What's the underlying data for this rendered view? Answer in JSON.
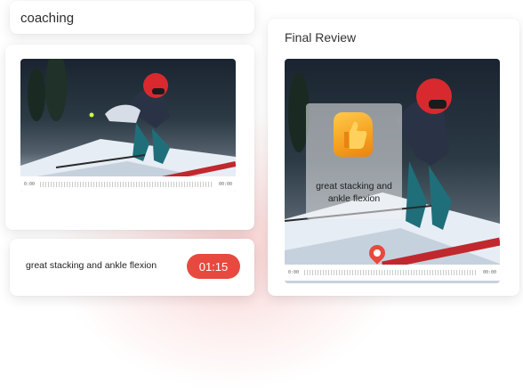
{
  "coaching_panel": {
    "title": "coaching",
    "video": {
      "time_start": "0:00",
      "time_end": "00:00"
    },
    "comment": {
      "text": "great stacking and ankle flexion",
      "timestamp": "01:15"
    }
  },
  "review_panel": {
    "title": "Final Review",
    "reaction_icon": "thumbs-up-icon",
    "overlay_text_line1": "great stacking and",
    "overlay_text_line2": "ankle flexion",
    "marker_icon": "comment-pin-icon",
    "video": {
      "time_start": "0:00",
      "time_end": "00:00"
    }
  },
  "colors": {
    "accent": "#e8493f",
    "text": "#2d2d2d",
    "background": "#ffffff"
  }
}
